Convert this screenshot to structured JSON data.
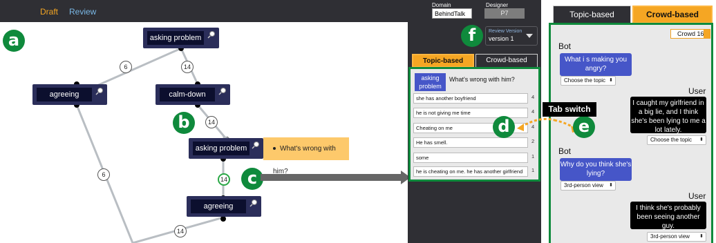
{
  "topbar": {
    "tabs": [
      "Draft",
      "Review"
    ],
    "domain_label": "Domain",
    "domain_value": "BehindTalk",
    "designer_label": "Designer",
    "designer_value": "P7"
  },
  "graph": {
    "nodes": {
      "asking_problem_1": "asking problem",
      "agreeing_1": "agreeing",
      "calm_down": "calm-down",
      "asking_problem_2": "asking problem",
      "agreeing_2": "agreeing"
    },
    "counts": {
      "e1": "6",
      "e2": "14",
      "e3": "14",
      "e4": "6",
      "e5": "14",
      "e6": "14"
    },
    "note": "What's wrong with him?"
  },
  "badges": {
    "a": "a",
    "b": "b",
    "c": "c",
    "d": "d",
    "e": "e",
    "f": "f"
  },
  "review_panel": {
    "version_label": "Review Version",
    "version_value": "version 1",
    "tabs": [
      "Topic-based",
      "Crowd-based"
    ],
    "topic_chip": "asking problem",
    "question": "What's wrong with him?",
    "answers": [
      {
        "text": "she has another boyfriend",
        "count": "4"
      },
      {
        "text": "he is not giving me time",
        "count": "4"
      },
      {
        "text": "Cheating on me",
        "count": "4"
      },
      {
        "text": "He has smell.",
        "count": "2"
      },
      {
        "text": "some",
        "count": "1"
      },
      {
        "text": "he is cheating on me. he has another girlfriend",
        "count": "1"
      }
    ]
  },
  "callout": "Tab switch",
  "crowd_panel": {
    "tabs": [
      "Topic-based",
      "Crowd-based"
    ],
    "crowd_select": "Crowd 16",
    "messages": [
      {
        "speaker": "Bot",
        "text": "What i s making you angry?",
        "select": "Choose the topic"
      },
      {
        "speaker": "User",
        "text": "I caught my girlfriend in a big lie, and I think she's been lying to me a lot lately.",
        "select": "Choose the topic"
      },
      {
        "speaker": "Bot",
        "text": "Why do you think she's lying?",
        "select": "3rd-person view"
      },
      {
        "speaker": "User",
        "text": "I think she's probably been seeing another guy.",
        "select": "3rd-person view"
      }
    ]
  },
  "colors": {
    "accent": "#f5a623",
    "badge_green": "#0f8a3c",
    "node": "#2b2e5a",
    "bot_bubble": "#4656c8",
    "panel_dark": "#2f2f34"
  }
}
